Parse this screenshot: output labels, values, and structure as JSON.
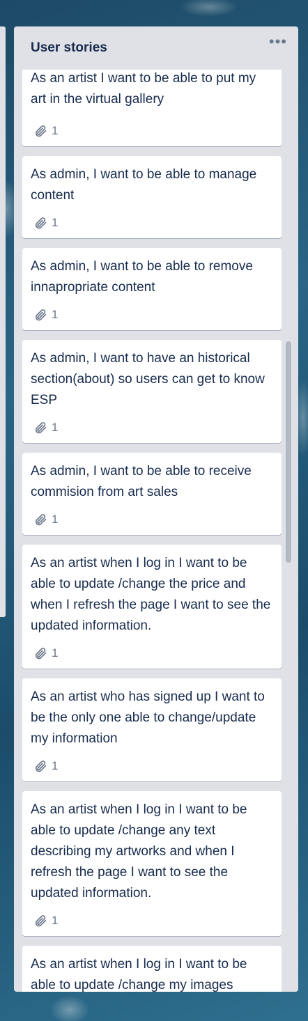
{
  "list": {
    "title": "User stories",
    "menu_label": "•••",
    "cards": [
      {
        "title": "As an artist I want to be able to put my art in the virtual gallery",
        "attachments": "1"
      },
      {
        "title": "As admin, I want to be able to manage content",
        "attachments": "1"
      },
      {
        "title": "As admin, I want to be able to remove innapropriate content",
        "attachments": "1"
      },
      {
        "title": "As admin, I want to have an historical section(about) so users can get to know ESP",
        "attachments": "1"
      },
      {
        "title": "As admin, I want to be able to receive commision from art sales",
        "attachments": "1"
      },
      {
        "title": "As an artist when I log in I want to be able to update /change the price and when I refresh the page I want to see the updated information.",
        "attachments": "1"
      },
      {
        "title": "As an artist who has signed up I want to be the only one able to change/update my information",
        "attachments": "1"
      },
      {
        "title": "As an artist when I log in I want to be able to update /change any text describing my artworks and when I refresh the page I want to see the updated information.",
        "attachments": "1"
      },
      {
        "title": "As an artist when I log in I want to be able to update /change my images",
        "attachments": ""
      }
    ]
  },
  "icons": {
    "attachment": "paperclip-icon",
    "menu": "more-horizontal-icon"
  }
}
